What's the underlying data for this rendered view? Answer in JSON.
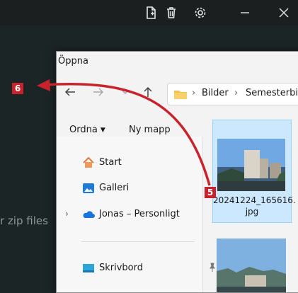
{
  "background_text": "r zip files",
  "colors": {
    "accent_red": "#c8232c",
    "selection": "#cce8ff",
    "app_bg": "#1c2526"
  },
  "toolbar": {
    "icons": [
      "new-file-icon",
      "trash-icon",
      "gear-icon",
      "minimize-icon",
      "close-icon"
    ]
  },
  "dialog": {
    "title": "Öppna",
    "breadcrumb": [
      "Bilder",
      "Semesterbil"
    ],
    "commands": {
      "organize": "Ordna",
      "new_folder": "Ny mapp"
    },
    "nav": [
      {
        "label": "Start",
        "icon": "home-icon"
      },
      {
        "label": "Galleri",
        "icon": "gallery-icon"
      },
      {
        "label": "Jonas – Personligt",
        "icon": "onedrive-cloud-icon"
      },
      {
        "label": "Skrivbord",
        "icon": "desktop-icon"
      }
    ],
    "files": [
      {
        "name_line1": "20241224_165616.",
        "name_line2": "jpg"
      }
    ]
  },
  "annotations": {
    "badge5": "5",
    "badge6": "6"
  }
}
